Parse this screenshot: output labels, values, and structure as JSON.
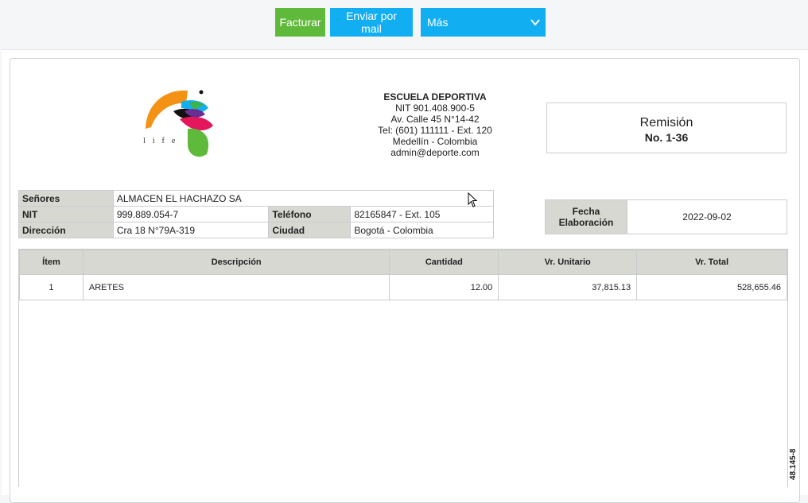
{
  "toolbar": {
    "facturar_label": "Facturar",
    "enviar_label": "Enviar por mail",
    "mas_label": "Más"
  },
  "colors": {
    "facturar_bg": "#5fba3b",
    "mail_bg": "#12aef2",
    "label_cell_bg": "#d8d8d2"
  },
  "logo": {
    "icon": "life-logo",
    "text": "life"
  },
  "company": {
    "name": "ESCUELA DEPORTIVA",
    "nit": "NIT 901.408.900-5",
    "address": "Av. Calle 45 N°14-42",
    "phone": "Tel: (601) 111111 - Ext. 120",
    "city": "Medellín - Colombia",
    "email": "admin@deporte.com"
  },
  "document": {
    "type": "Remisión",
    "number": "No. 1-36",
    "fecha_label": "Fecha Elaboración",
    "fecha_value": "2022-09-02"
  },
  "client": {
    "senores_label": "Señores",
    "senores_value": "ALMACEN EL HACHAZO SA",
    "nit_label": "NIT",
    "nit_value": "999.889.054-7",
    "telefono_label": "Teléfono",
    "telefono_value": "82165847 - Ext. 105",
    "direccion_label": "Dirección",
    "direccion_value": "Cra 18 N°79A-319",
    "ciudad_label": "Ciudad",
    "ciudad_value": "Bogotá - Colombia"
  },
  "items": {
    "headers": [
      "Ítem",
      "Descripción",
      "Cantidad",
      "Vr. Unitario",
      "Vr. Total"
    ],
    "rows": [
      [
        "1",
        "ARETES",
        "12.00",
        "37,815.13",
        "528,655.46"
      ]
    ]
  },
  "side_text": "48.145-8"
}
